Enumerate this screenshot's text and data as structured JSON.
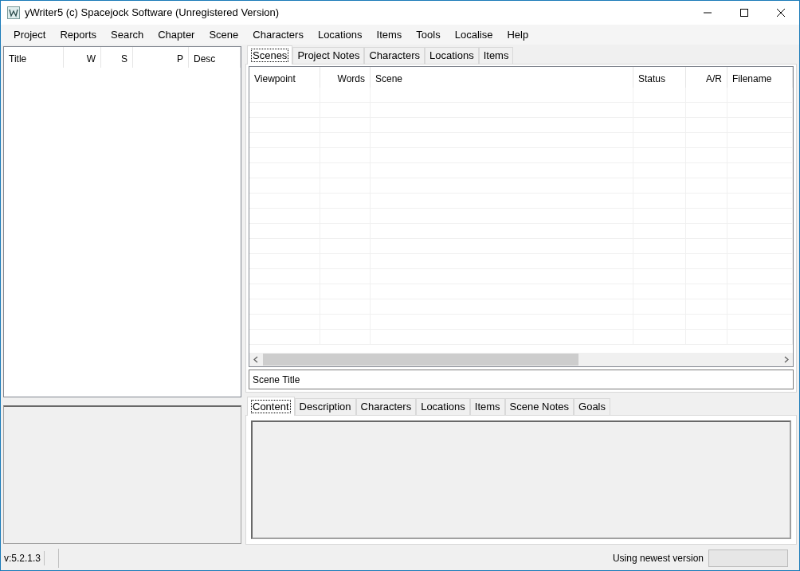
{
  "window": {
    "title": "yWriter5 (c) Spacejock Software (Unregistered Version)"
  },
  "menu": [
    "Project",
    "Reports",
    "Search",
    "Chapter",
    "Scene",
    "Characters",
    "Locations",
    "Items",
    "Tools",
    "Localise",
    "Help"
  ],
  "chapter_list": {
    "columns": [
      "Title",
      "W",
      "S",
      "P",
      "Desc"
    ]
  },
  "top_tabs": [
    {
      "label": "Scenes",
      "selected": true
    },
    {
      "label": "Project Notes",
      "selected": false
    },
    {
      "label": "Characters",
      "selected": false
    },
    {
      "label": "Locations",
      "selected": false
    },
    {
      "label": "Items",
      "selected": false
    }
  ],
  "scene_table": {
    "columns": [
      "Viewpoint",
      "Words",
      "Scene",
      "Status",
      "A/R",
      "Filename"
    ]
  },
  "scene_title": {
    "value": "Scene Title"
  },
  "bottom_tabs": [
    {
      "label": "Content",
      "selected": true
    },
    {
      "label": "Description",
      "selected": false
    },
    {
      "label": "Characters",
      "selected": false
    },
    {
      "label": "Locations",
      "selected": false
    },
    {
      "label": "Items",
      "selected": false
    },
    {
      "label": "Scene Notes",
      "selected": false
    },
    {
      "label": "Goals",
      "selected": false
    }
  ],
  "status_bar": {
    "version": "v:5.2.1.3",
    "message": "Using newest version",
    "progress": {
      "level": 0
    }
  }
}
